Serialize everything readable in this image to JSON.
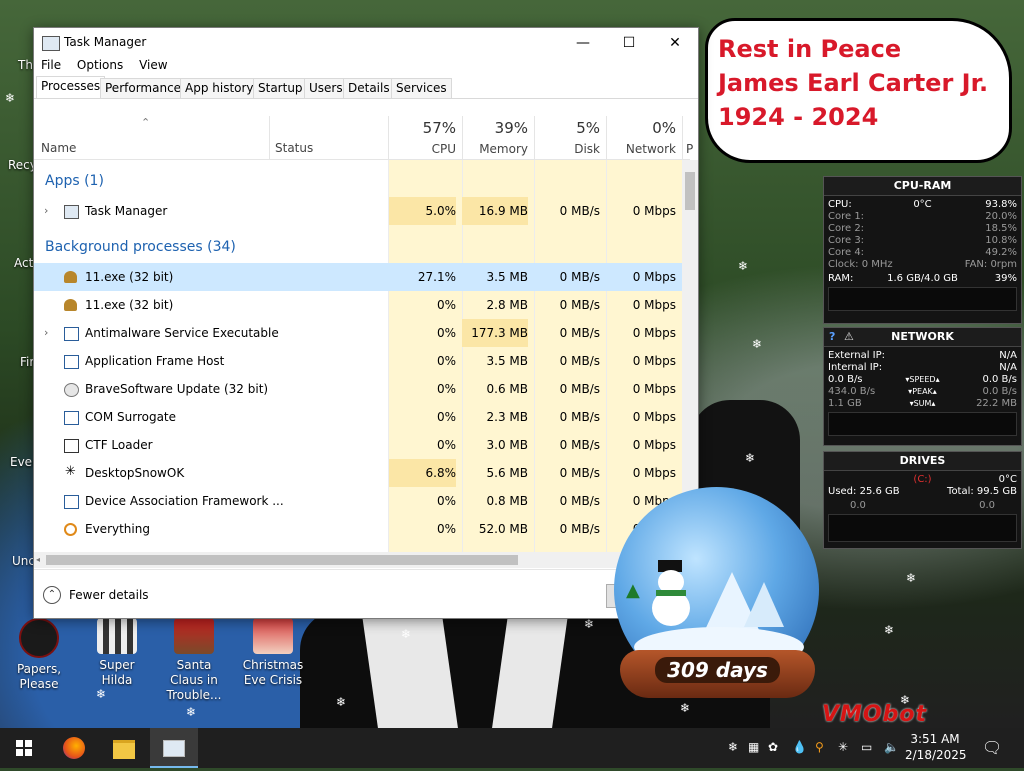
{
  "task_manager": {
    "title": "Task Manager",
    "menu": [
      "File",
      "Options",
      "View"
    ],
    "tabs": [
      "Processes",
      "Performance",
      "App history",
      "Startup",
      "Users",
      "Details",
      "Services"
    ],
    "columns": {
      "name": "Name",
      "status": "Status",
      "cpu": {
        "pct": "57%",
        "label": "CPU"
      },
      "memory": {
        "pct": "39%",
        "label": "Memory"
      },
      "disk": {
        "pct": "5%",
        "label": "Disk"
      },
      "network": {
        "pct": "0%",
        "label": "Network"
      },
      "power_partial": "P"
    },
    "groups": {
      "apps": "Apps (1)",
      "background": "Background processes (34)"
    },
    "rows": [
      {
        "name": "Task Manager",
        "cpu": "5.0%",
        "memory": "16.9 MB",
        "disk": "0 MB/s",
        "network": "0 Mbps"
      },
      {
        "name": "11.exe (32 bit)",
        "cpu": "27.1%",
        "memory": "3.5 MB",
        "disk": "0 MB/s",
        "network": "0 Mbps"
      },
      {
        "name": "11.exe (32 bit)",
        "cpu": "0%",
        "memory": "2.8 MB",
        "disk": "0 MB/s",
        "network": "0 Mbps"
      },
      {
        "name": "Antimalware Service Executable",
        "cpu": "0%",
        "memory": "177.3 MB",
        "disk": "0 MB/s",
        "network": "0 Mbps"
      },
      {
        "name": "Application Frame Host",
        "cpu": "0%",
        "memory": "3.5 MB",
        "disk": "0 MB/s",
        "network": "0 Mbps"
      },
      {
        "name": "BraveSoftware Update (32 bit)",
        "cpu": "0%",
        "memory": "0.6 MB",
        "disk": "0 MB/s",
        "network": "0 Mbps"
      },
      {
        "name": "COM Surrogate",
        "cpu": "0%",
        "memory": "2.3 MB",
        "disk": "0 MB/s",
        "network": "0 Mbps"
      },
      {
        "name": "CTF Loader",
        "cpu": "0%",
        "memory": "3.0 MB",
        "disk": "0 MB/s",
        "network": "0 Mbps"
      },
      {
        "name": "DesktopSnowOK",
        "cpu": "6.8%",
        "memory": "5.6 MB",
        "disk": "0 MB/s",
        "network": "0 Mbps"
      },
      {
        "name": "Device Association Framework ...",
        "cpu": "0%",
        "memory": "0.8 MB",
        "disk": "0 MB/s",
        "network": "0 Mbps"
      },
      {
        "name": "Everything",
        "cpu": "0%",
        "memory": "52.0 MB",
        "disk": "0 MB/s",
        "network": "0 Mbps"
      }
    ],
    "fewer_details": "Fewer details"
  },
  "desktop_icons": [
    {
      "label": "Papers, Please"
    },
    {
      "label": "Super Hilda"
    },
    {
      "label": "Santa Claus in Trouble..."
    },
    {
      "label": "Christmas Eve Crisis"
    }
  ],
  "partial_icon_labels": [
    "Th",
    "Recy",
    "Act",
    "Fir",
    "Ever",
    "Unc"
  ],
  "bubble": {
    "line1": "Rest in Peace",
    "line2": "James Earl Carter Jr.",
    "line3": "1924 - 2024"
  },
  "cpu_ram": {
    "title": "CPU-RAM",
    "cpu_label": "CPU:",
    "cpu_temp": "0°C",
    "cpu_pct": "93.8%",
    "cores": [
      {
        "label": "Core 1:",
        "value": "20.0%"
      },
      {
        "label": "Core 2:",
        "value": "18.5%"
      },
      {
        "label": "Core 3:",
        "value": "10.8%"
      },
      {
        "label": "Core 4:",
        "value": "49.2%"
      }
    ],
    "clock": "Clock: 0 MHz",
    "fan": "FAN: 0rpm",
    "ram_label": "RAM:",
    "ram_value": "1.6 GB/4.0 GB",
    "ram_pct": "39%"
  },
  "network": {
    "help": "?",
    "warn": "⚠",
    "title": "NETWORK",
    "external_ip_label": "External IP:",
    "external_ip": "N/A",
    "internal_ip_label": "Internal IP:",
    "internal_ip": "N/A",
    "speed_left": "0.0 B/s",
    "speed_label": "▾SPEED▴",
    "speed_right": "0.0 B/s",
    "peak_left": "434.0 B/s",
    "peak_label": "▾PEAK▴",
    "peak_right": "0.0 B/s",
    "sum_left": "1.1 GB",
    "sum_label": "▾SUM▴",
    "sum_right": "22.2 MB"
  },
  "drives": {
    "title": "DRIVES",
    "temp": "0°C",
    "drive": "(C:)",
    "used": "Used: 25.6 GB",
    "total": "Total: 99.5 GB",
    "left_value": "0.0",
    "right_value": "0.0"
  },
  "snow_globe": {
    "days": "309 days"
  },
  "watermark": "VMObot",
  "taskbar": {
    "time": "3:51 AM",
    "date": "2/18/2025"
  }
}
